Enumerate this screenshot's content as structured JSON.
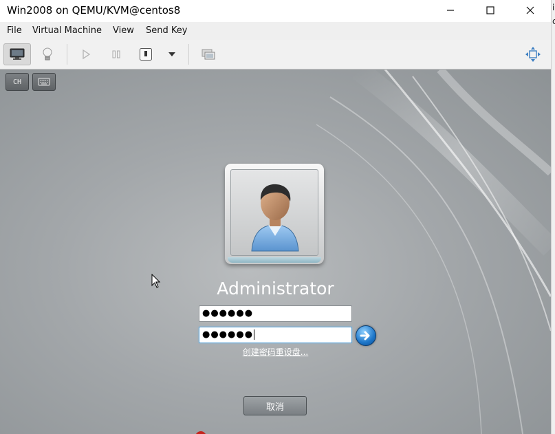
{
  "window": {
    "title": "Win2008 on QEMU/KVM@centos8",
    "controls": [
      "minimize-icon",
      "maximize-icon",
      "close-icon"
    ]
  },
  "menubar": {
    "items": [
      "File",
      "Virtual Machine",
      "View",
      "Send Key"
    ]
  },
  "toolbar": {
    "buttons": [
      {
        "icon": "monitor-console-icon",
        "active": true
      },
      {
        "icon": "lightbulb-details-icon"
      },
      {
        "icon": "play-run-icon",
        "disabled": true
      },
      {
        "icon": "pause-icon",
        "disabled": true
      },
      {
        "icon": "shutdown-icon"
      },
      {
        "icon": "dropdown-arrow-icon"
      },
      {
        "icon": "snapshots-icon"
      },
      {
        "icon": "fullscreen-resize-icon"
      }
    ]
  },
  "vm_screen": {
    "lang_button": "CH",
    "keyboard_icon": "keyboard-icon",
    "user_picture_icon": "user-avatar-icon",
    "username": "Administrator",
    "password_1": "●●●●●●",
    "password_2": "●●●●●●",
    "submit_icon": "arrow-right-icon",
    "reset_link": "创建密码重设盘...",
    "cancel_label": "取消"
  },
  "colors": {
    "screen_bg": "#a3a7aa",
    "go_button": "#1d76c9",
    "input_focus": "#5a9fd1"
  }
}
